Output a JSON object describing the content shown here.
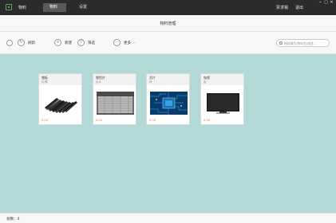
{
  "app": {
    "title": "物料",
    "logo_icon": "app-logo-icon"
  },
  "tabs": [
    {
      "label": "物料",
      "active": true
    },
    {
      "label": "设置",
      "active": false
    }
  ],
  "top_links": {
    "user": "贾求锡",
    "logout": "退出"
  },
  "window_controls": [
    "−",
    "▢",
    "✕"
  ],
  "page": {
    "title": "物料管理"
  },
  "toolbar": {
    "refresh_label": "刷新",
    "new_label": "新建",
    "filter_label": "筛选",
    "more_label": "更多",
    "search_placeholder": "物料编号/物料名/描述..."
  },
  "cards": [
    {
      "name": "锂板",
      "unit": "片/件",
      "price": "0.00",
      "image": "lithium-plates"
    },
    {
      "name": "锂铝片",
      "unit": "片/1",
      "price": "0.00",
      "image": "aluminum-sheets"
    },
    {
      "name": "芯片",
      "unit": "块",
      "price": "0.00",
      "image": "circuit-chip"
    },
    {
      "name": "电视",
      "unit": "台",
      "price": "0.00",
      "image": "tv-monitor"
    }
  ],
  "status": {
    "total_label": "总数：",
    "total": "4"
  },
  "colors": {
    "titlebar": "#2b2b2b",
    "content_bg": "#b2d8d8",
    "price": "#e07b39"
  }
}
